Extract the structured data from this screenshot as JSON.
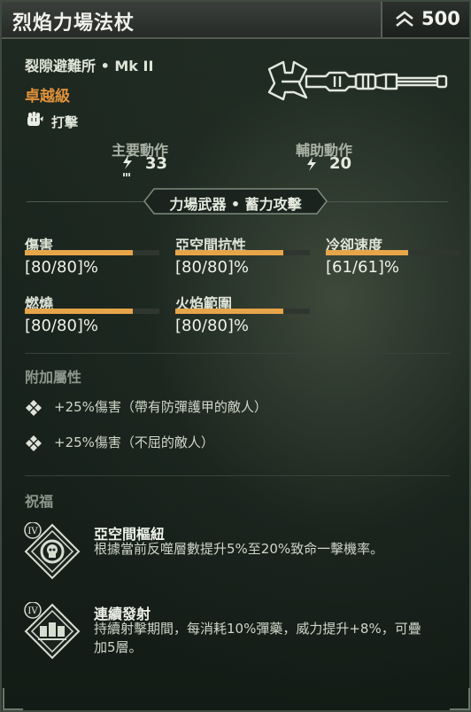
{
  "item": {
    "name": "烈焰力場法杖",
    "power": "500",
    "origin": "裂隙避難所 • Mk II",
    "rarity": "卓越級",
    "damage_type": "打擊",
    "icons": {
      "power": "chevron-rank-icon",
      "damage_type": "fist-icon",
      "weapon": "force-staff-illustration"
    }
  },
  "actions": {
    "primary_label": "主要動作",
    "primary_value": "33",
    "secondary_label": "輔助動作",
    "secondary_value": "20"
  },
  "keyword": "力場武器 • 蓄力攻擊",
  "stats": [
    {
      "name": "傷害",
      "value": "[80/80]%",
      "fill": 0.8
    },
    {
      "name": "亞空間抗性",
      "value": "[80/80]%",
      "fill": 0.8
    },
    {
      "name": "冷卻速度",
      "value": "[61/61]%",
      "fill": 0.61
    },
    {
      "name": "燃燒",
      "value": "[80/80]%",
      "fill": 0.8
    },
    {
      "name": "火焰範圍",
      "value": "[80/80]%",
      "fill": 0.8
    }
  ],
  "modifiers": {
    "heading": "附加屬性",
    "items": [
      "+25%傷害（帶有防彈護甲的敵人）",
      "+25%傷害（不屈的敵人）"
    ]
  },
  "blessings": {
    "heading": "祝福",
    "items": [
      {
        "tier": "IV",
        "name": "亞空間樞紐",
        "description": "根據當前反噬層數提升5%至20%致命一擊機率。",
        "icon": "skull-blessing-icon"
      },
      {
        "tier": "IV",
        "name": "連續發射",
        "description": "持續射擊期間，每消耗10%彈藥，威力提升+8%，可疊加5層。",
        "icon": "rapid-fire-blessing-icon"
      }
    ]
  },
  "colors": {
    "rarity": "#e0913a",
    "stat_bar": "#e7a54a",
    "background": "#1a241e"
  }
}
